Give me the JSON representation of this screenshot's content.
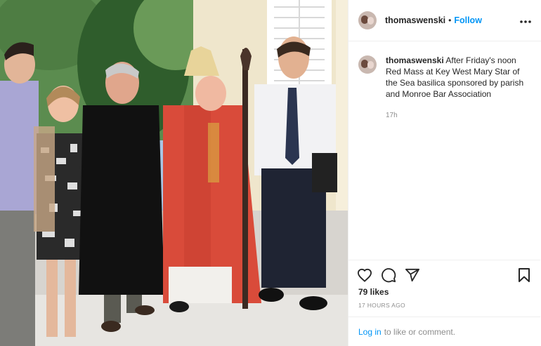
{
  "post": {
    "username": "thomaswenski",
    "separator": "•",
    "follow_label": "Follow",
    "more_label": "•••",
    "caption_text": "After Friday's noon Red Mass at Key West Mary Star of the Sea basilica sponsored by parish and Monroe Bar Association",
    "caption_time": "17h",
    "likes": "79 likes",
    "timestamp": "17 HOURS AGO",
    "login_link": "Log in",
    "login_rest": "to like or comment."
  },
  "icons": {
    "like": "heart-icon",
    "comment": "comment-icon",
    "share": "share-icon",
    "save": "bookmark-icon",
    "more": "more-options-icon"
  },
  "colors": {
    "accent": "#0095f6",
    "secondary_text": "#8e8e8e",
    "border": "#efefef"
  }
}
